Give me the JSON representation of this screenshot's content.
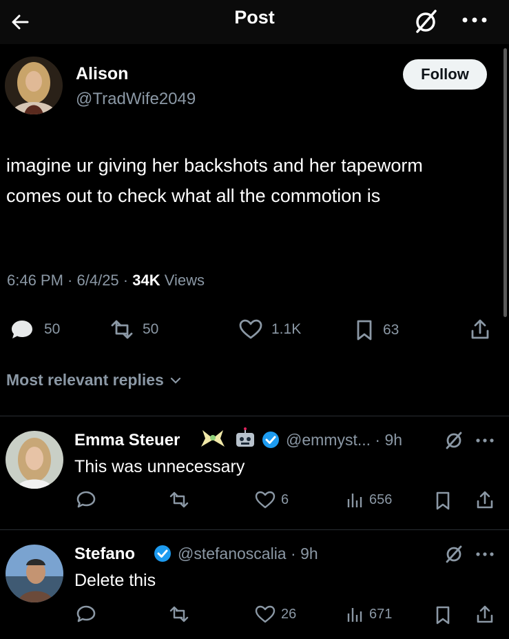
{
  "header": {
    "title": "Post"
  },
  "post": {
    "author_name": "Alison",
    "author_handle": "@TradWife2049",
    "follow_label": "Follow",
    "text": "imagine ur giving her backshots and her tapeworm comes out to check what all the commotion is",
    "time": "6:46 PM",
    "date": "6/4/25",
    "views_count": "34K",
    "views_label": "Views",
    "replies": "50",
    "reposts": "50",
    "likes": "1.1K",
    "bookmarks": "63"
  },
  "section_label": "Most relevant replies",
  "replies": [
    {
      "name": "Emma Steuer",
      "handle": "@emmyst...",
      "time": "9h",
      "text": "This was unnecessary",
      "likes": "6",
      "views": "656"
    },
    {
      "name": "Stefano",
      "handle": "@stefanoscalia",
      "time": "9h",
      "text": "Delete this",
      "likes": "26",
      "views": "671"
    }
  ],
  "colors": {
    "background": "#000000",
    "secondary_text": "#8b98a5",
    "verified": "#1d9bf0"
  }
}
